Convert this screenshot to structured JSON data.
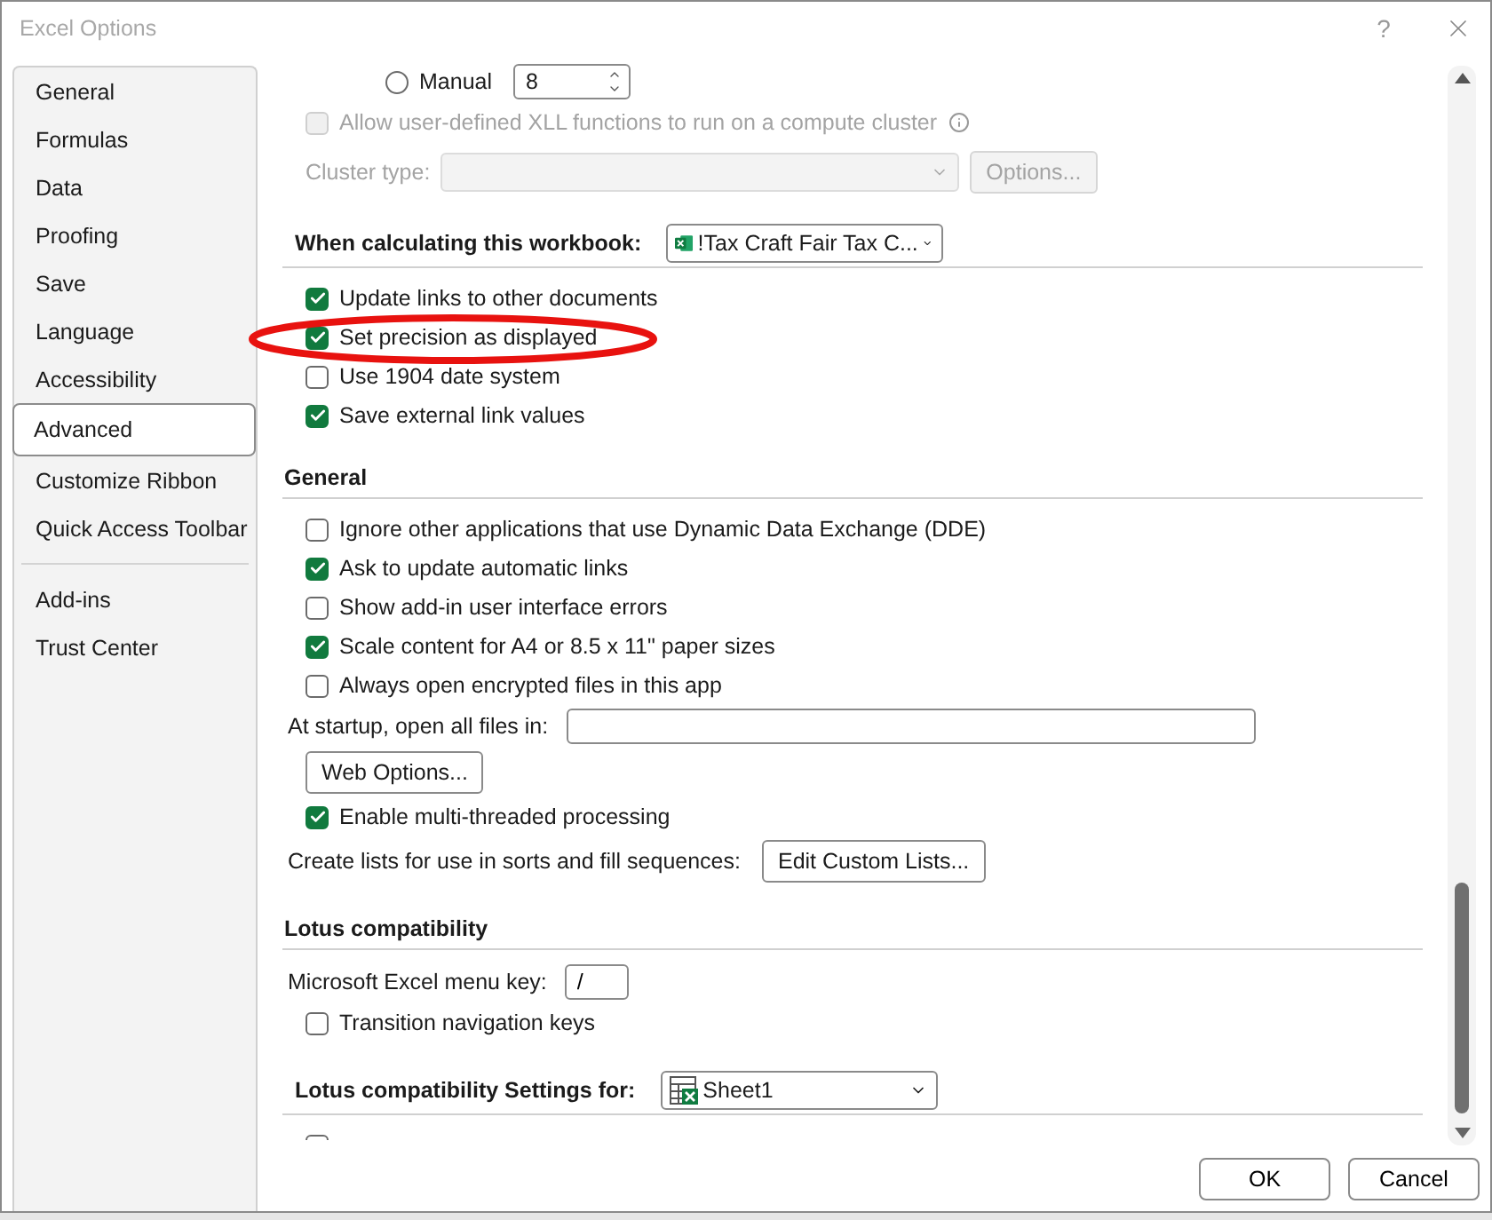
{
  "window": {
    "title": "Excel Options",
    "help": "?"
  },
  "sidebar": {
    "groups": [
      [
        {
          "label": "General",
          "selected": false
        },
        {
          "label": "Formulas",
          "selected": false
        },
        {
          "label": "Data",
          "selected": false
        },
        {
          "label": "Proofing",
          "selected": false
        },
        {
          "label": "Save",
          "selected": false
        },
        {
          "label": "Language",
          "selected": false
        },
        {
          "label": "Accessibility",
          "selected": false
        },
        {
          "label": "Advanced",
          "selected": true
        },
        {
          "label": "Customize Ribbon",
          "selected": false
        },
        {
          "label": "Quick Access Toolbar",
          "selected": false
        }
      ],
      [
        {
          "label": "Add-ins",
          "selected": false
        },
        {
          "label": "Trust Center",
          "selected": false
        }
      ]
    ]
  },
  "content": {
    "rows": [
      {
        "kind": "radio",
        "label": "Manual",
        "selected": false,
        "value": "8"
      },
      {
        "kind": "checkbox-info",
        "label": "Allow user-defined XLL functions to run on a compute cluster",
        "checked": false,
        "disabled": true
      },
      {
        "kind": "cluster",
        "label": "Cluster type:",
        "button": "Options...",
        "disabled": true
      },
      {
        "kind": "workbook-select",
        "label": "When calculating this workbook:",
        "value": "!Tax Craft Fair Tax C..."
      },
      {
        "kind": "checkbox",
        "label": "Update links to other documents",
        "checked": true
      },
      {
        "kind": "checkbox",
        "label": "Set precision as displayed",
        "checked": true
      },
      {
        "kind": "checkbox",
        "label": "Use 1904 date system",
        "checked": false
      },
      {
        "kind": "checkbox",
        "label": "Save external link values",
        "checked": true
      },
      {
        "kind": "section",
        "label": "General"
      },
      {
        "kind": "checkbox",
        "label": "Ignore other applications that use Dynamic Data Exchange (DDE)",
        "checked": false
      },
      {
        "kind": "checkbox",
        "label": "Ask to update automatic links",
        "checked": true
      },
      {
        "kind": "checkbox",
        "label": "Show add-in user interface errors",
        "checked": false
      },
      {
        "kind": "checkbox",
        "label": "Scale content for A4 or 8.5 x 11\" paper sizes",
        "checked": true
      },
      {
        "kind": "checkbox",
        "label": "Always open encrypted files in this app",
        "checked": false
      },
      {
        "kind": "field",
        "label": "At startup, open all files in:"
      },
      {
        "kind": "button",
        "label": "Web Options..."
      },
      {
        "kind": "checkbox",
        "label": "Enable multi-threaded processing",
        "checked": true
      },
      {
        "kind": "label-button",
        "label": "Create lists for use in sorts and fill sequences:",
        "button": "Edit Custom Lists..."
      },
      {
        "kind": "section",
        "label": "Lotus compatibility"
      },
      {
        "kind": "small-field",
        "label": "Microsoft Excel menu key:",
        "value": "/"
      },
      {
        "kind": "checkbox",
        "label": "Transition navigation keys",
        "checked": false
      },
      {
        "kind": "sheet-select",
        "label": "Lotus compatibility Settings for:",
        "value": "Sheet1"
      },
      {
        "kind": "cut-checkbox",
        "checked": false
      }
    ]
  },
  "buttons": [
    {
      "label": "OK"
    },
    {
      "label": "Cancel"
    }
  ]
}
